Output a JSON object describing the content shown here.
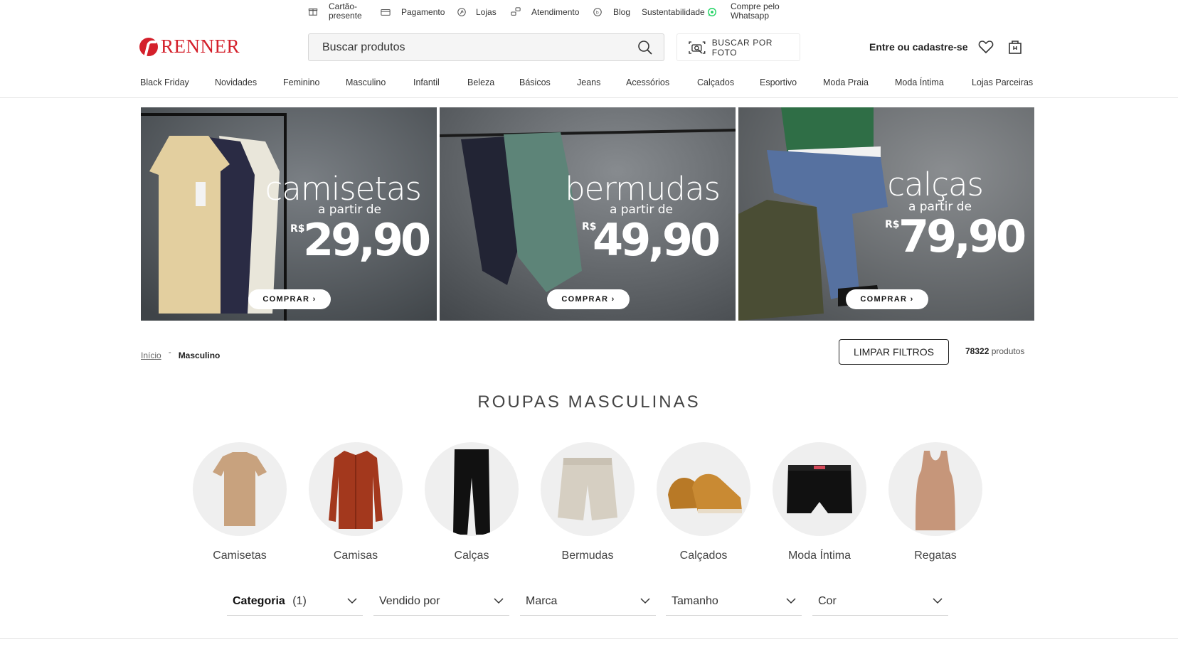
{
  "utility": [
    {
      "label": "Cartão-\npresente",
      "icon": "gift-icon"
    },
    {
      "label": "Pagamento",
      "icon": "card-icon"
    },
    {
      "label": "Lojas",
      "icon": "store-pin-icon"
    },
    {
      "label": "Atendimento",
      "icon": "support-icon"
    },
    {
      "label": "Blog",
      "icon": "blog-icon"
    },
    {
      "label": "Sustentabilidade",
      "icon": "whatsapp-icon"
    },
    {
      "label": "Compre pelo\nWhatsapp",
      "icon": ""
    }
  ],
  "header": {
    "logo": "RENNER",
    "search_placeholder": "Buscar produtos",
    "photo_search": "BUSCAR POR FOTO",
    "login": "Entre ou cadastre-se"
  },
  "nav": [
    "Black Friday",
    "Novidades",
    "Feminino",
    "Masculino",
    "Infantil",
    "Beleza",
    "Básicos",
    "Jeans",
    "Acessórios",
    "Calçados",
    "Esportivo",
    "Moda Praia",
    "Moda Íntima",
    "Lojas Parceiras"
  ],
  "banners": [
    {
      "title": "camisetas",
      "sub": "a partir de",
      "currency": "R$",
      "price": "29,90",
      "cta": "COMPRAR ›"
    },
    {
      "title": "bermudas",
      "sub": "a partir de",
      "currency": "R$",
      "price": "49,90",
      "cta": "COMPRAR ›"
    },
    {
      "title": "calças",
      "sub": "a partir de",
      "currency": "R$",
      "price": "79,90",
      "cta": "COMPRAR ›"
    }
  ],
  "breadcrumb": {
    "home": "Início",
    "separator": "-",
    "current": "Masculino"
  },
  "clear_filters": "LIMPAR FILTROS",
  "product_count": "78322",
  "product_count_suffix": " produtos",
  "page_title": "ROUPAS MASCULINAS",
  "categories": [
    "Camisetas",
    "Camisas",
    "Calças",
    "Bermudas",
    "Calçados",
    "Moda Íntima",
    "Regatas"
  ],
  "filters": [
    {
      "label": "Categoria",
      "count": "(1)"
    },
    {
      "label": "Vendido por",
      "count": ""
    },
    {
      "label": "Marca",
      "count": ""
    },
    {
      "label": "Tamanho",
      "count": ""
    },
    {
      "label": "Cor",
      "count": ""
    }
  ],
  "colors": {
    "brand": "#d4202b",
    "whatsapp": "#25d366"
  }
}
